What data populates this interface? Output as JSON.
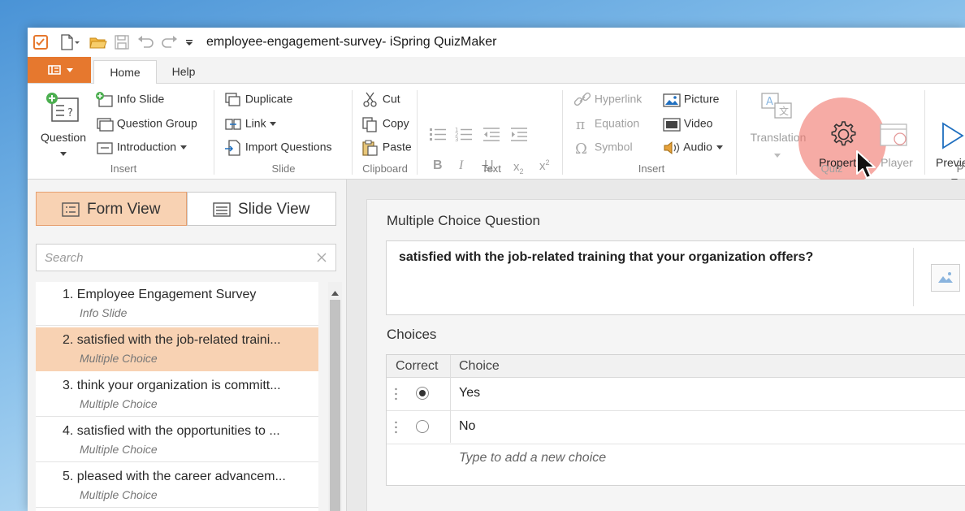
{
  "window": {
    "title": "employee-engagement-survey- iSpring QuizMaker"
  },
  "tabs": [
    {
      "label": "Home"
    },
    {
      "label": "Help"
    }
  ],
  "ribbon": {
    "insert1": {
      "question": "Question",
      "info_slide": "Info Slide",
      "question_group": "Question Group",
      "introduction": "Introduction",
      "group_label": "Insert"
    },
    "slide": {
      "duplicate": "Duplicate",
      "link": "Link",
      "import_questions": "Import Questions",
      "group_label": "Slide"
    },
    "clipboard": {
      "cut": "Cut",
      "copy": "Copy",
      "paste": "Paste",
      "group_label": "Clipboard"
    },
    "text": {
      "bold": "B",
      "italic": "I",
      "underline": "U",
      "subscript": "x",
      "superscript": "x",
      "group_label": "Text"
    },
    "insert2": {
      "hyperlink": "Hyperlink",
      "equation": "Equation",
      "symbol": "Symbol",
      "picture": "Picture",
      "video": "Video",
      "audio": "Audio",
      "group_label": "Insert"
    },
    "quiz": {
      "translation": "Translation",
      "properties": "Properties",
      "player": "Player",
      "group_label": "Quiz"
    },
    "preview": {
      "label": "Previe",
      "group_label": "P"
    }
  },
  "left": {
    "form_view": "Form View",
    "slide_view": "Slide View",
    "search_placeholder": "Search",
    "slides": [
      {
        "title": "1.  Employee Engagement Survey",
        "type": "Info Slide"
      },
      {
        "title": "2.  satisfied with the job-related traini...",
        "type": "Multiple Choice"
      },
      {
        "title": "3.  think your organization is committ...",
        "type": "Multiple Choice"
      },
      {
        "title": "4.  satisfied with the opportunities to ...",
        "type": "Multiple Choice"
      },
      {
        "title": "5.  pleased with the career advancem...",
        "type": "Multiple Choice"
      }
    ]
  },
  "editor": {
    "section_title": "Multiple Choice Question",
    "question_text": "satisfied with the job-related training that your organization offers?",
    "choices_title": "Choices",
    "col_correct": "Correct",
    "col_choice": "Choice",
    "choices": [
      {
        "text": "Yes",
        "correct": true
      },
      {
        "text": "No",
        "correct": false
      }
    ],
    "add_placeholder": "Type to add a new choice"
  },
  "colors": {
    "accent": "#e6782e",
    "selection": "#f8d2b3",
    "highlight": "#f0786e"
  }
}
